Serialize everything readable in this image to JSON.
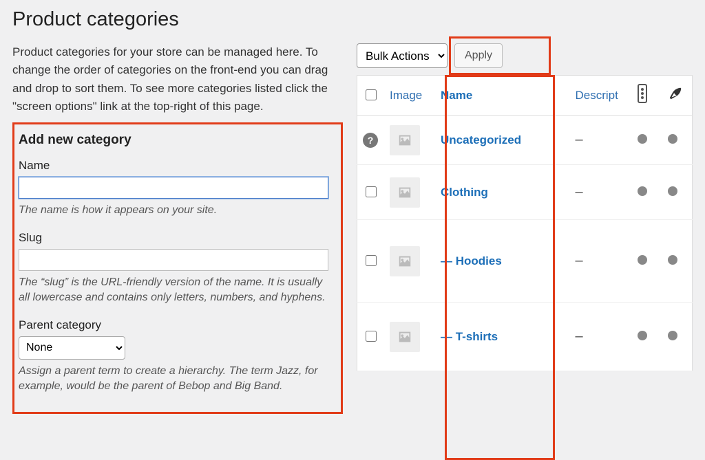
{
  "page_title": "Product categories",
  "intro": "Product categories for your store can be managed here. To change the order of categories on the front-end you can drag and drop to sort them. To see more categories listed click the \"screen options\" link at the top-right of this page.",
  "form": {
    "title": "Add new category",
    "name_label": "Name",
    "name_value": "",
    "name_hint": "The name is how it appears on your site.",
    "slug_label": "Slug",
    "slug_value": "",
    "slug_hint": "The “slug” is the URL-friendly version of the name. It is usually all lowercase and contains only letters, numbers, and hyphens.",
    "parent_label": "Parent category",
    "parent_selected": "None",
    "parent_hint": "Assign a parent term to create a hierarchy. The term Jazz, for example, would be the parent of Bebop and Big Band."
  },
  "bulk": {
    "select_label": "Bulk Actions",
    "apply_label": "Apply"
  },
  "table": {
    "headers": {
      "image": "Image",
      "name": "Name",
      "description": "Descript"
    },
    "rows": [
      {
        "name": "Uncategorized",
        "desc": "–",
        "help": true,
        "indent": ""
      },
      {
        "name": "Clothing",
        "desc": "–",
        "help": false,
        "indent": ""
      },
      {
        "name": "Hoodies",
        "desc": "–",
        "help": false,
        "indent": "— "
      },
      {
        "name": "T-shirts",
        "desc": "–",
        "help": false,
        "indent": "— "
      }
    ]
  }
}
